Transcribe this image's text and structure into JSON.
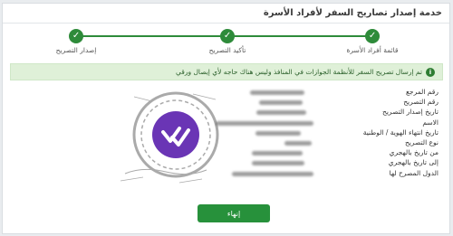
{
  "header": {
    "title": "خدمة إصدار تصاريح السفر لأفراد الأسرة"
  },
  "stepper": {
    "steps": [
      {
        "label": "قائمة أفراد الأسرة",
        "icon": "check-icon"
      },
      {
        "label": "تأكيد التصريح",
        "icon": "check-icon"
      },
      {
        "label": "إصدار التصريح",
        "icon": "check-icon"
      }
    ]
  },
  "alert": {
    "text": "تم إرسال تصريح السفر للأنظمة الجوازات في المنافذ وليس هناك حاجه لأي إيصال ورقي",
    "icon": "info-icon"
  },
  "permit": {
    "fields": [
      "رقم المرجع",
      "رقم التصريح",
      "تاريخ إصدار التصريح",
      "الاسم",
      "تاريخ انتهاء الهوية / الوطنية",
      "نوع التصريح",
      "من تاريخ بالهجري",
      "إلى تاريخ بالهجري",
      "الدول المصرح لها"
    ]
  },
  "actions": {
    "finish_label": "إنهاء"
  },
  "colors": {
    "accent": "#2e8b3a",
    "alert_bg": "#dff0d8",
    "stamp_purple": "#6a35b5"
  }
}
